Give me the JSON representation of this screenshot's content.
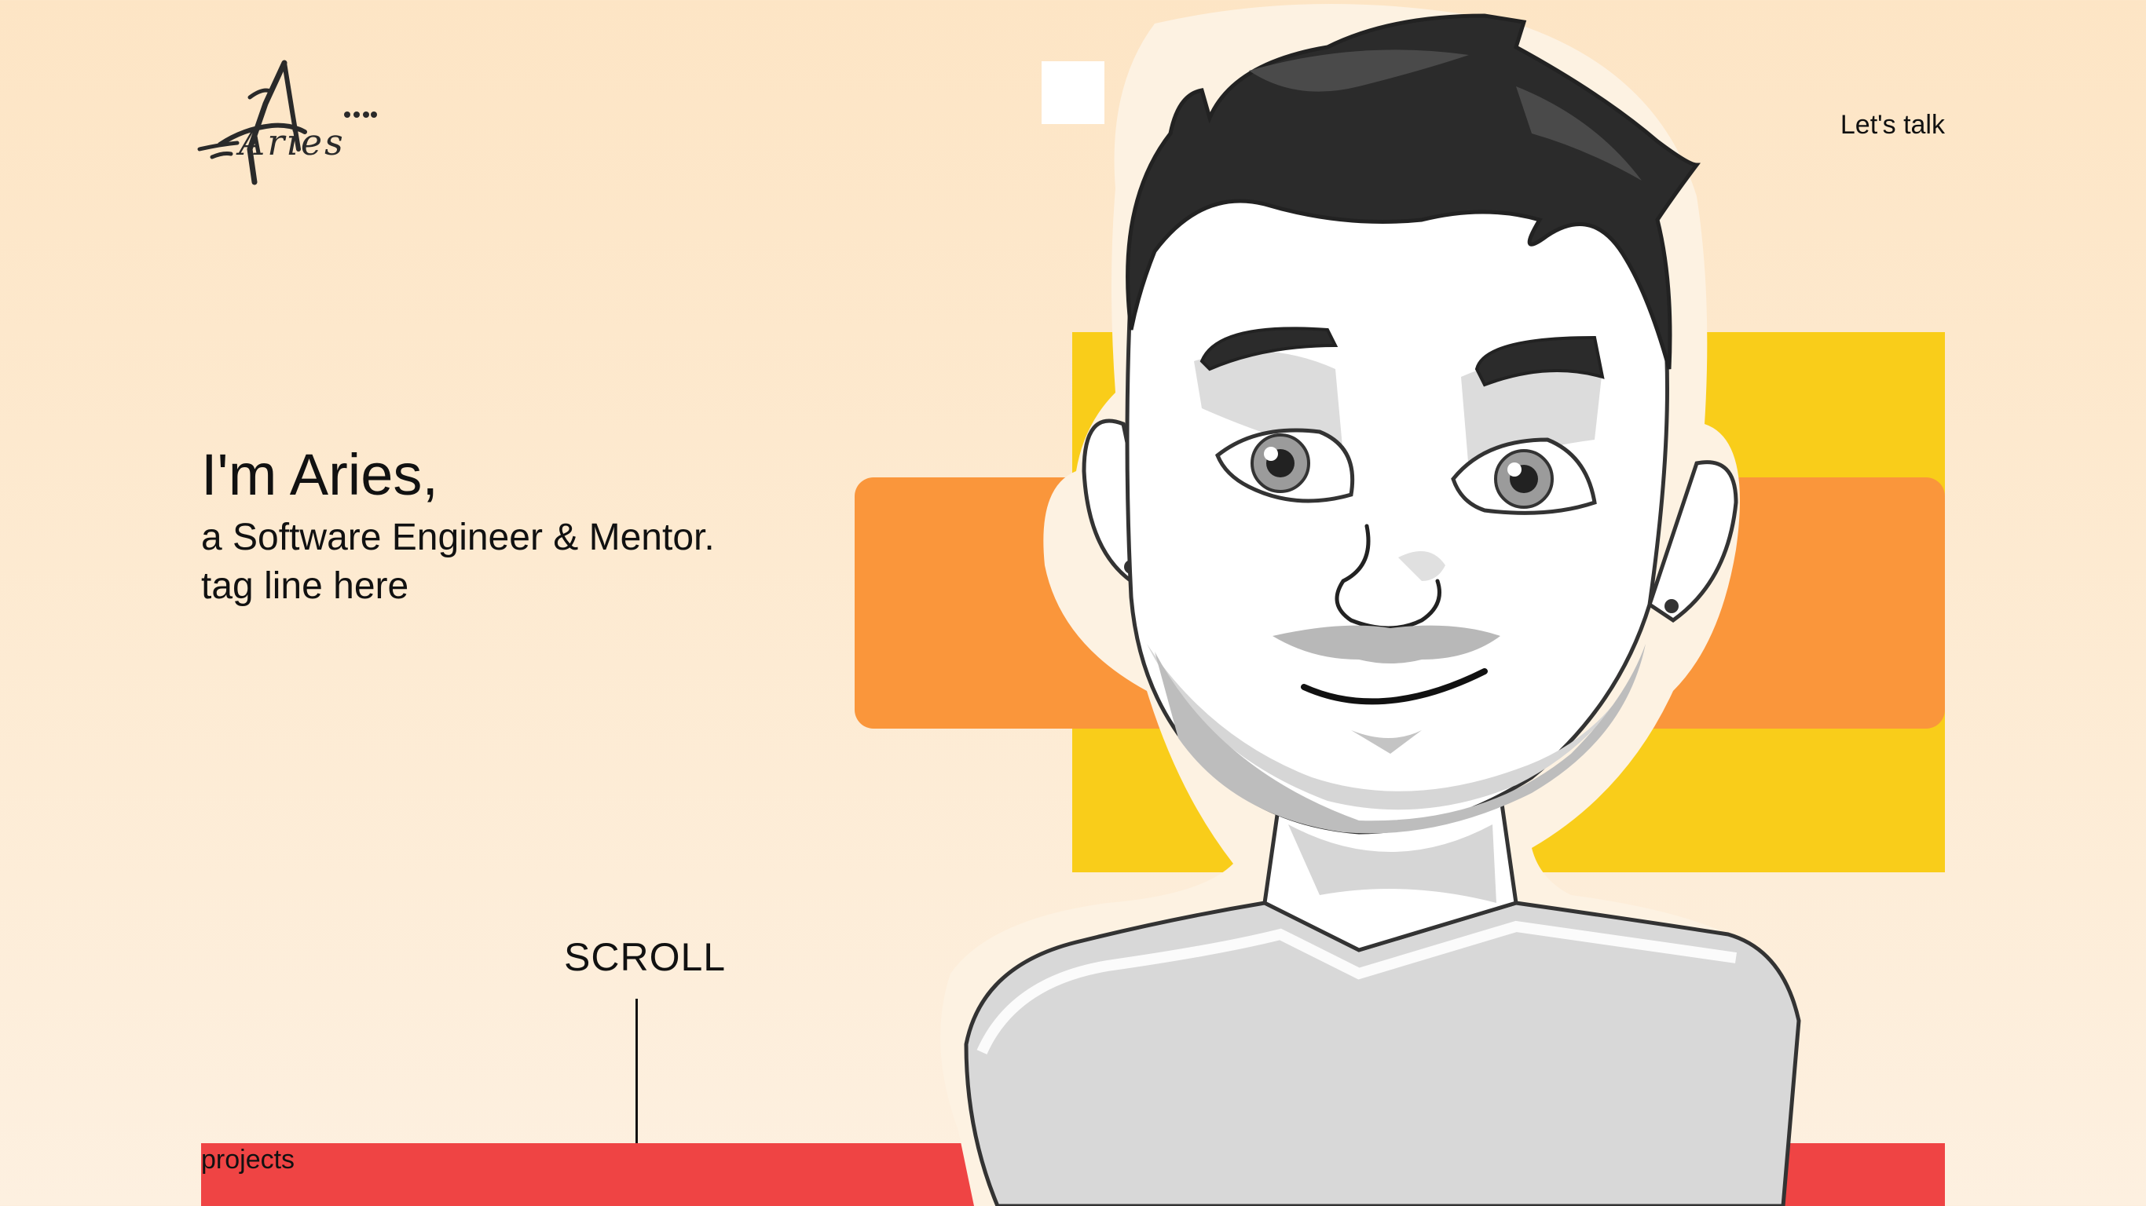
{
  "header": {
    "logo_text": "Aries",
    "cta_label": "Let's talk"
  },
  "hero": {
    "title": "I'm Aries,",
    "subtitle": "a Software Engineer & Mentor.",
    "tagline": "tag line here"
  },
  "scroll": {
    "label": "SCROLL"
  },
  "footer": {
    "projects_label": "projects"
  },
  "colors": {
    "background": "#fde8cc",
    "yellow": "#f9cd1a",
    "orange": "#fa963b",
    "red": "#ef4444",
    "hair": "#2b2b2b",
    "skin": "#ffffff",
    "shadow": "#d6d6d6"
  },
  "icons": {
    "avatar": "cartoon-avatar-portrait",
    "logo": "aries-signature-logo"
  }
}
